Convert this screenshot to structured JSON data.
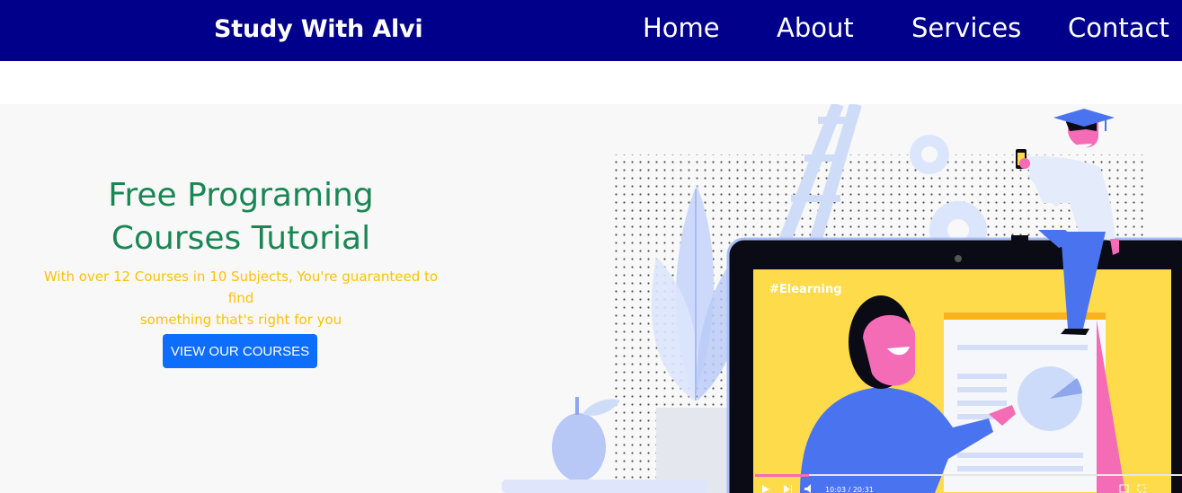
{
  "navbar": {
    "brand": "Study With Alvi",
    "links": [
      "Home",
      "About",
      "Services",
      "Contact"
    ]
  },
  "hero": {
    "title_line1": "Free Programing",
    "title_line2": "Courses Tutorial",
    "subtitle_line1": "With over 12 Courses in 10 Subjects, You're guaranteed to find",
    "subtitle_line2": "something that's right for you",
    "cta_label": "VIEW OUR COURSES"
  },
  "illustration": {
    "screen_tag": "#Elearning",
    "video_time": "10:03 / 20:31"
  },
  "colors": {
    "navbar_bg": "#00008b",
    "title": "#198754",
    "subtitle": "#ffc107",
    "button": "#0d6efd"
  }
}
